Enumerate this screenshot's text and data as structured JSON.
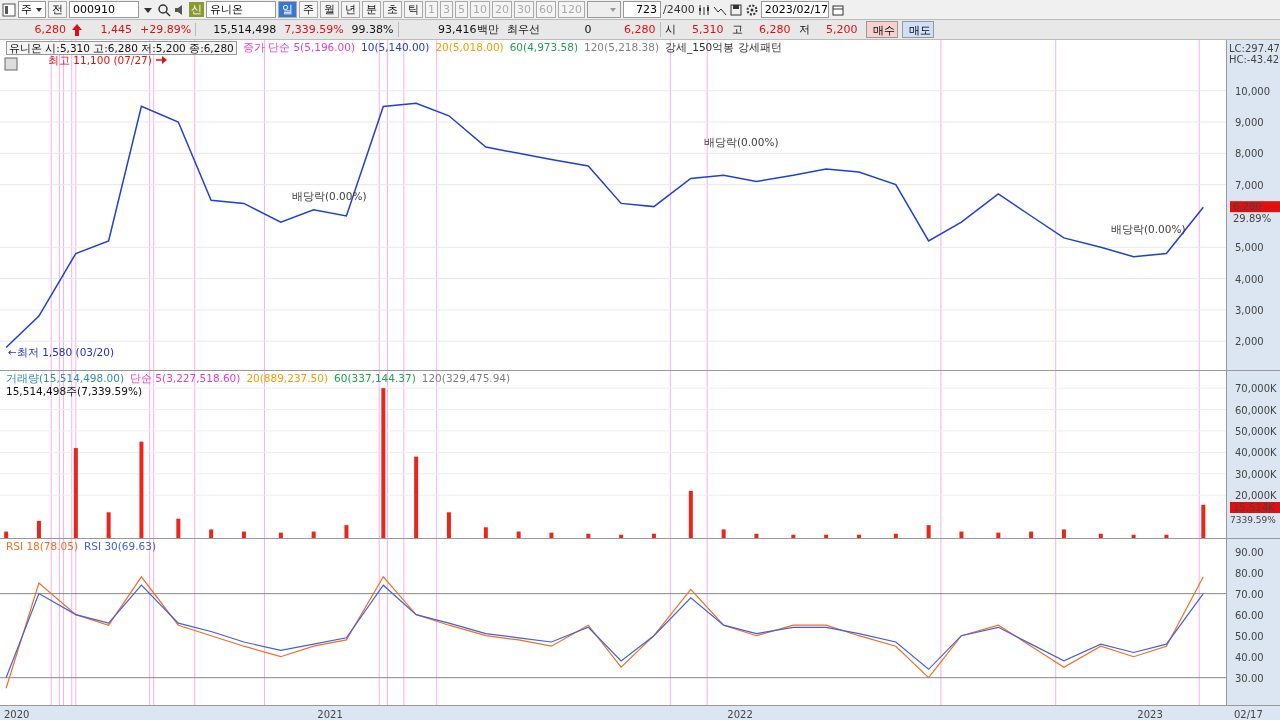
{
  "toolbar": {
    "market": "주",
    "all": "전",
    "code": "000910",
    "badge": "신",
    "name": "유니온",
    "periods": [
      {
        "label": "일",
        "selected": true
      },
      {
        "label": "주",
        "selected": false
      },
      {
        "label": "월",
        "selected": false
      },
      {
        "label": "년",
        "selected": false
      },
      {
        "label": "분",
        "selected": false
      },
      {
        "label": "초",
        "selected": false
      },
      {
        "label": "틱",
        "selected": false
      }
    ],
    "intervals": [
      {
        "label": "1",
        "disabled": true
      },
      {
        "label": "3",
        "disabled": true
      },
      {
        "label": "5",
        "disabled": true
      },
      {
        "label": "10",
        "disabled": true
      },
      {
        "label": "20",
        "disabled": true
      },
      {
        "label": "30",
        "disabled": true
      },
      {
        "label": "60",
        "disabled": true
      },
      {
        "label": "120",
        "disabled": true
      }
    ],
    "count": "723",
    "total": "/2400",
    "date": "2023/02/17"
  },
  "quote": {
    "price": "6,280",
    "change": "1,445",
    "rate": "+29.89%",
    "volume": "15,514,498",
    "volume_rate": "7,339.59%",
    "ratio": "99.38%",
    "amount": "93,416백만",
    "best_label": "최우선",
    "best_qty": "0",
    "best_price": "6,280",
    "open_label": "시",
    "open": "5,310",
    "high_label": "고",
    "high": "6,280",
    "low_label": "저",
    "low": "5,200"
  },
  "buttons": [
    {
      "label": "매수",
      "kind": "buy"
    },
    {
      "label": "매도",
      "kind": "sell"
    }
  ],
  "price_panel": {
    "summary": "유니온 시:5,310 고:6,280 저:5,200 종:6,280",
    "legend": [
      {
        "text": "증가 단순 5(5,196.00)",
        "color": "#e040c0"
      },
      {
        "text": "10(5,140.00)",
        "color": "#2040c8"
      },
      {
        "text": "20(5,018.00)",
        "color": "#f0a000"
      },
      {
        "text": "60(4,973.58)",
        "color": "#20a050"
      },
      {
        "text": "120(5,218.38)",
        "color": "#808080"
      },
      {
        "text": "강세_150억봉 강세패턴",
        "color": "#303030"
      }
    ],
    "lc": "LC:297.47",
    "hc": "HC:-43.42",
    "price_tag": "6,280",
    "rate_tag": "29.89%",
    "chart_data": {
      "type": "line",
      "grid": true,
      "xlim": [
        2020.195,
        2023.317
      ],
      "ref_lines": [
        {
          "axis": "x",
          "value": 2020.32
        },
        {
          "axis": "x",
          "value": 2020.34
        },
        {
          "axis": "x",
          "value": 2020.35
        },
        {
          "axis": "x",
          "value": 2020.37
        },
        {
          "axis": "x",
          "value": 2020.38
        },
        {
          "axis": "x",
          "value": 2020.56
        },
        {
          "axis": "x",
          "value": 2020.57
        },
        {
          "axis": "x",
          "value": 2020.67
        },
        {
          "axis": "x",
          "value": 2020.84
        },
        {
          "axis": "x",
          "value": 2021.12
        },
        {
          "axis": "x",
          "value": 2021.14
        },
        {
          "axis": "x",
          "value": 2021.18
        },
        {
          "axis": "x",
          "value": 2021.26
        },
        {
          "axis": "x",
          "value": 2021.83
        },
        {
          "axis": "x",
          "value": 2021.92
        },
        {
          "axis": "x",
          "value": 2022.49
        },
        {
          "axis": "x",
          "value": 2022.77
        },
        {
          "axis": "x",
          "value": 2023.12
        }
      ],
      "x": [
        2020.21,
        2020.29,
        2020.38,
        2020.46,
        2020.54,
        2020.63,
        2020.71,
        2020.79,
        2020.88,
        2020.96,
        2021.04,
        2021.13,
        2021.21,
        2021.29,
        2021.38,
        2021.46,
        2021.54,
        2021.63,
        2021.71,
        2021.79,
        2021.88,
        2021.96,
        2022.04,
        2022.13,
        2022.21,
        2022.29,
        2022.38,
        2022.46,
        2022.54,
        2022.63,
        2022.71,
        2022.79,
        2022.88,
        2022.96,
        2023.04,
        2023.13
      ],
      "series": [
        {
          "color": "#2040d0",
          "values": [
            1800,
            2800,
            4800,
            5200,
            9500,
            9000,
            6500,
            6400,
            5800,
            6200,
            6000,
            9500,
            9600,
            9200,
            8200,
            8000,
            7800,
            7600,
            6400,
            6300,
            7200,
            7300,
            7100,
            7300,
            7500,
            7400,
            7000,
            5200,
            5800,
            6700,
            6000,
            5300,
            5000,
            4700,
            4800,
            6280
          ]
        }
      ],
      "ylim": [
        1080,
        11620
      ],
      "yticks": [
        {
          "value": 2000,
          "label": "2,000"
        },
        {
          "value": 3000,
          "label": "3,000"
        },
        {
          "value": 4000,
          "label": "4,000"
        },
        {
          "value": 5000,
          "label": "5,000"
        },
        {
          "value": 7000,
          "label": "7,000"
        },
        {
          "value": 8000,
          "label": "8,000"
        },
        {
          "value": 9000,
          "label": "9,000"
        },
        {
          "value": 10000,
          "label": "10,000"
        }
      ],
      "annotations": [
        "최고 11,100 (07/27)",
        "←최저 1,580 (03/20)",
        "배당락(0.00%)",
        "배당락(0.00%)",
        "배당락(0.00%)"
      ]
    }
  },
  "volume_panel": {
    "legend": [
      {
        "text": "거래량(15,514,498.00)",
        "color": "#3090a0"
      },
      {
        "text": "단순 5(3,227,518.60)",
        "color": "#e040c0"
      },
      {
        "text": "20(889,237.50)",
        "color": "#f0a000"
      },
      {
        "text": "60(337,144.37)",
        "color": "#20a050"
      },
      {
        "text": "120(329,475.94)",
        "color": "#808080"
      }
    ],
    "sub": "15,514,498주(7,339.59%)",
    "volume_tag": "15,514K",
    "rate_tag": "7339.59%",
    "chart_data": {
      "type": "bar",
      "grid": true,
      "xlim": [
        2020.195,
        2023.317
      ],
      "ref_lines": [
        {
          "axis": "x",
          "value": 2020.32
        },
        {
          "axis": "x",
          "value": 2020.34
        },
        {
          "axis": "x",
          "value": 2020.35
        },
        {
          "axis": "x",
          "value": 2020.37
        },
        {
          "axis": "x",
          "value": 2020.38
        },
        {
          "axis": "x",
          "value": 2020.56
        },
        {
          "axis": "x",
          "value": 2020.57
        },
        {
          "axis": "x",
          "value": 2020.67
        },
        {
          "axis": "x",
          "value": 2020.84
        },
        {
          "axis": "x",
          "value": 2021.12
        },
        {
          "axis": "x",
          "value": 2021.14
        },
        {
          "axis": "x",
          "value": 2021.18
        },
        {
          "axis": "x",
          "value": 2021.26
        },
        {
          "axis": "x",
          "value": 2021.83
        },
        {
          "axis": "x",
          "value": 2021.92
        },
        {
          "axis": "x",
          "value": 2022.49
        },
        {
          "axis": "x",
          "value": 2022.77
        },
        {
          "axis": "x",
          "value": 2023.12
        }
      ],
      "x": [
        2020.21,
        2020.29,
        2020.38,
        2020.46,
        2020.54,
        2020.63,
        2020.71,
        2020.79,
        2020.88,
        2020.96,
        2021.04,
        2021.13,
        2021.21,
        2021.29,
        2021.38,
        2021.46,
        2021.54,
        2021.63,
        2021.71,
        2021.79,
        2021.88,
        2021.96,
        2022.04,
        2022.13,
        2022.21,
        2022.29,
        2022.38,
        2022.46,
        2022.54,
        2022.63,
        2022.71,
        2022.79,
        2022.88,
        2022.96,
        2023.04,
        2023.13
      ],
      "series": [
        {
          "color": "#e8261c",
          "values": [
            3000,
            8000,
            42000,
            12000,
            45000,
            9000,
            4000,
            3000,
            2500,
            3000,
            6000,
            70000,
            38000,
            12000,
            5000,
            3000,
            2500,
            2000,
            1500,
            2000,
            22000,
            4000,
            2000,
            1500,
            1500,
            1500,
            2000,
            6000,
            3000,
            2500,
            3000,
            4000,
            2000,
            1500,
            1500,
            15500
          ]
        }
      ],
      "ylim": [
        0,
        78000
      ],
      "yticks": [
        {
          "value": 20000,
          "label": "20,000K"
        },
        {
          "value": 30000,
          "label": "30,000K"
        },
        {
          "value": 40000,
          "label": "40,000K"
        },
        {
          "value": 50000,
          "label": "50,000K"
        },
        {
          "value": 60000,
          "label": "60,000K"
        },
        {
          "value": 70000,
          "label": "70,000K"
        }
      ]
    }
  },
  "rsi_panel": {
    "legend": [
      {
        "text": "RSI 18(78.05)",
        "color": "#f07020"
      },
      {
        "text": "RSI 30(69.63)",
        "color": "#4060e0"
      }
    ],
    "start_label": "2020",
    "date_tag": "02/17",
    "chart_data": {
      "type": "line",
      "grid": true,
      "xlim": [
        2020.195,
        2023.317
      ],
      "ref_lines": [
        {
          "axis": "x",
          "value": 2020.32
        },
        {
          "axis": "x",
          "value": 2020.34
        },
        {
          "axis": "x",
          "value": 2020.35
        },
        {
          "axis": "x",
          "value": 2020.37
        },
        {
          "axis": "x",
          "value": 2020.38
        },
        {
          "axis": "x",
          "value": 2020.56
        },
        {
          "axis": "x",
          "value": 2020.57
        },
        {
          "axis": "x",
          "value": 2020.67
        },
        {
          "axis": "x",
          "value": 2020.84
        },
        {
          "axis": "x",
          "value": 2021.12
        },
        {
          "axis": "x",
          "value": 2021.14
        },
        {
          "axis": "x",
          "value": 2021.18
        },
        {
          "axis": "x",
          "value": 2021.26
        },
        {
          "axis": "x",
          "value": 2021.83
        },
        {
          "axis": "x",
          "value": 2021.92
        },
        {
          "axis": "x",
          "value": 2022.49
        },
        {
          "axis": "x",
          "value": 2022.77
        },
        {
          "axis": "x",
          "value": 2023.12
        }
      ],
      "x": [
        2020.21,
        2020.29,
        2020.38,
        2020.46,
        2020.54,
        2020.63,
        2020.71,
        2020.79,
        2020.88,
        2020.96,
        2021.04,
        2021.13,
        2021.21,
        2021.29,
        2021.38,
        2021.46,
        2021.54,
        2021.63,
        2021.71,
        2021.79,
        2021.88,
        2021.96,
        2022.04,
        2022.13,
        2022.21,
        2022.29,
        2022.38,
        2022.46,
        2022.54,
        2022.63,
        2022.71,
        2022.79,
        2022.88,
        2022.96,
        2023.04,
        2023.13
      ],
      "series": [
        {
          "color": "#f07020",
          "values": [
            25,
            75,
            60,
            55,
            78,
            55,
            50,
            45,
            40,
            45,
            48,
            78,
            60,
            55,
            50,
            48,
            45,
            55,
            35,
            50,
            72,
            55,
            50,
            55,
            55,
            50,
            45,
            30,
            50,
            55,
            45,
            35,
            45,
            40,
            45,
            78
          ]
        },
        {
          "color": "#4060e0",
          "values": [
            30,
            70,
            60,
            56,
            74,
            56,
            52,
            47,
            43,
            46,
            49,
            74,
            60,
            56,
            51,
            49,
            47,
            54,
            38,
            50,
            68,
            55,
            51,
            54,
            54,
            51,
            47,
            34,
            50,
            54,
            46,
            38,
            46,
            42,
            46,
            70
          ]
        }
      ],
      "ylim": [
        17,
        96
      ],
      "yticks": [
        {
          "value": 30,
          "label": "30.00"
        },
        {
          "value": 40,
          "label": "40.00"
        },
        {
          "value": 50,
          "label": "50.00"
        },
        {
          "value": 60,
          "label": "60.00"
        },
        {
          "value": 70,
          "label": "70.00"
        },
        {
          "value": 80,
          "label": "80.00"
        },
        {
          "value": 90,
          "label": "90.00"
        }
      ],
      "xticks": [
        {
          "value": 2021,
          "label": "2021"
        },
        {
          "value": 2022,
          "label": "2022"
        },
        {
          "value": 2023,
          "label": "2023"
        }
      ]
    }
  }
}
